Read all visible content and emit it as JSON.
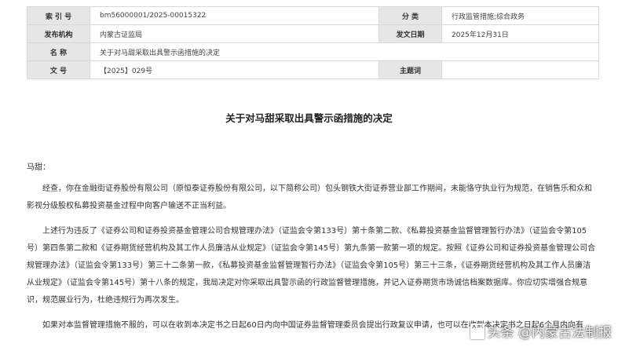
{
  "meta": {
    "index_label": "索 引 号",
    "index_value": "bm56000001/2025-00015322",
    "category_label": "分 类",
    "category_value": "行政监管措施;综合政务",
    "publisher_label": "发布机构",
    "publisher_value": "内蒙古证监局",
    "date_label": "发文日期",
    "date_value": "2025年12月31日",
    "name_label": "名 称",
    "name_value": "关于对马甜采取出具警示函措施的决定",
    "docno_label": "文 号",
    "docno_value": "【2025】029号",
    "subject_label": "主题词",
    "subject_value": ""
  },
  "document": {
    "title": "关于对马甜采取出具警示函措施的决定",
    "salutation": "马甜：",
    "paragraphs": [
      "经查，你在金融街证券股份有限公司（原恒泰证券股份有限公司，以下简称公司）包头钢铁大街证券营业部工作期间，未能恪守执业行为规范，在销售乐和众和影视分级股权私募投资基金过程中向客户输送不正当利益。",
      "上述行为违反了《证券公司和证券投资基金管理公司合规管理办法》（证监会令第133号）第十条第二款、《私募投资基金监督管理暂行办法》（证监会令第105号）第四条第二款和《证券期货经营机构及其工作人员廉洁从业规定》（证监会令第145号）第九条第一款第一项的规定。按照《证券公司和证券投资基金管理公司合规管理办法》（证监会令第133号）第三十二条第一款，《私募投资基金监督管理暂行办法》（证监会令第105号）第三十三条，《证券期货经营机构及其工作人员廉洁从业规定》（证监会令第145号）第十八条的规定，我局决定对你采取出具警示函的行政监督管理措施，并记入证券期货市场诚信档案数据库。你应切实增强合规意识，规范展业行为，杜绝违规行为再次发生。",
      "如果对本监督管理措施不服的，可以在收到本决定书之日起60日内向中国证券监督管理委员会提出行政复议申请，也可以在收到本决定书之日起6个月内向有"
    ]
  },
  "watermark": {
    "text": "头条 @内蒙古法制报"
  }
}
